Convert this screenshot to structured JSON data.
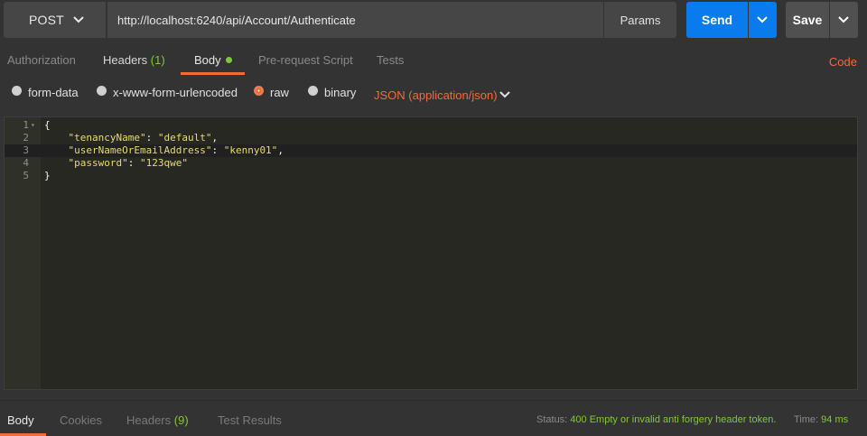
{
  "request": {
    "method": "POST",
    "url": "http://localhost:6240/api/Account/Authenticate",
    "params_label": "Params",
    "send_label": "Send",
    "save_label": "Save"
  },
  "request_tabs": {
    "authorization": "Authorization",
    "headers": "Headers",
    "headers_count": "(1)",
    "body": "Body",
    "prerequest": "Pre-request Script",
    "tests": "Tests",
    "code": "Code"
  },
  "body_types": {
    "form_data": "form-data",
    "urlencoded": "x-www-form-urlencoded",
    "raw": "raw",
    "binary": "binary",
    "selected": "raw",
    "content_type": "JSON (application/json)"
  },
  "editor": {
    "lines": [
      {
        "num": "1",
        "text": "{"
      },
      {
        "num": "2",
        "key": "\"tenancyName\"",
        "value": "\"default\"",
        "tail": ","
      },
      {
        "num": "3",
        "key": "\"userNameOrEmailAddress\"",
        "value": "\"kenny01\"",
        "tail": ","
      },
      {
        "num": "4",
        "key": "\"password\"",
        "value": "\"123qwe\"",
        "tail": ""
      },
      {
        "num": "5",
        "text": "}"
      }
    ],
    "current_line": 3
  },
  "response_tabs": {
    "body": "Body",
    "cookies": "Cookies",
    "headers": "Headers",
    "headers_count": "(9)",
    "test_results": "Test Results"
  },
  "response_status": {
    "status_label": "Status:",
    "status_value": "400 Empty or invalid anti forgery header token.",
    "time_label": "Time:",
    "time_value": "94 ms"
  },
  "colors": {
    "accent": "#f26b3a",
    "send_blue": "#097bed",
    "success_green": "#7ec93a",
    "editor_bg": "#272822"
  },
  "icons": [
    "chevron-down-icon",
    "radio-icon",
    "fold-arrow-icon"
  ]
}
